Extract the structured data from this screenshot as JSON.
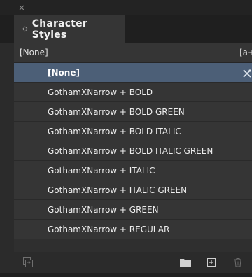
{
  "window": {
    "close_glyph": "×"
  },
  "tab": {
    "label": "Character Styles",
    "sort_glyph": "◇"
  },
  "current_style": {
    "label": "[None]",
    "quick_apply_label": "[a+]"
  },
  "styles": [
    {
      "label": "[None]",
      "selected": true
    },
    {
      "label": "GothamXNarrow + BOLD",
      "selected": false
    },
    {
      "label": "GothamXNarrow + BOLD GREEN",
      "selected": false
    },
    {
      "label": "GothamXNarrow + BOLD ITALIC",
      "selected": false
    },
    {
      "label": "GothamXNarrow + BOLD ITALIC GREEN",
      "selected": false
    },
    {
      "label": "GothamXNarrow + ITALIC",
      "selected": false
    },
    {
      "label": "GothamXNarrow + ITALIC GREEN",
      "selected": false
    },
    {
      "label": "GothamXNarrow + GREEN",
      "selected": false
    },
    {
      "label": "GothamXNarrow + REGULAR",
      "selected": false
    }
  ],
  "footer": {
    "icons": [
      "load-styles-icon",
      "new-group-folder-icon",
      "new-style-icon",
      "delete-icon"
    ]
  },
  "colors": {
    "selection": "#4c5f77",
    "panel": "#353535",
    "background": "#2f2f2f"
  }
}
